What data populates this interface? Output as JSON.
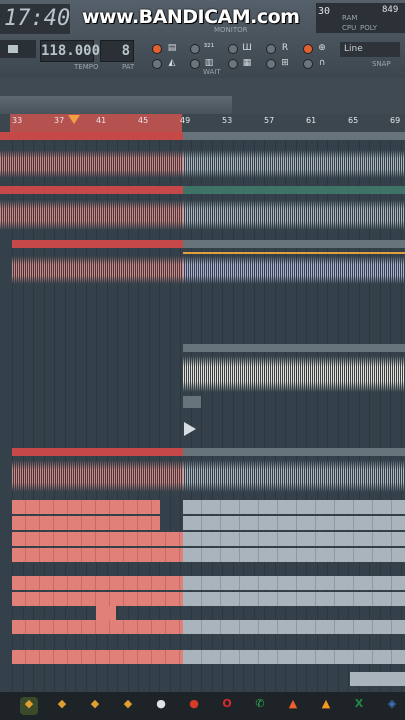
{
  "watermark": "www.BANDICAM.com",
  "toolbar": {
    "time": "17:40",
    "tempo": "118.000",
    "tempo_label": "TEMPO",
    "pattern": "8",
    "pattern_label": "PAT",
    "monitor_label": "MONITOR",
    "snap_mode": "Line",
    "snap_label": "SNAP",
    "cpu_value": "30",
    "ram_value": "849",
    "cpu_label": "CPU",
    "poly_label": "POLY",
    "ram_label": "RAM",
    "wait_label": "WAIT"
  },
  "playlist": {
    "bar_numbers": [
      "33",
      "37",
      "41",
      "45",
      "49",
      "53",
      "57",
      "61",
      "65",
      "69"
    ],
    "colors": {
      "selected_clip": "#e08078",
      "clip_gray": "#a9b4bc",
      "clip_cream": "#e6dfd2",
      "clip_lavender": "#aab0cf",
      "header_red": "#c64848",
      "header_teal": "#3f7368",
      "header_gray": "#67747c"
    }
  },
  "taskbar": {
    "icons": [
      "fl-studio-icon",
      "fl-studio-icon-2",
      "fl-studio-icon-3",
      "fl-studio-icon-4",
      "obs-icon",
      "bandicam-icon",
      "opera-icon",
      "whatsapp-icon",
      "brave-icon",
      "vlc-icon",
      "excel-icon",
      "network-icon"
    ]
  }
}
